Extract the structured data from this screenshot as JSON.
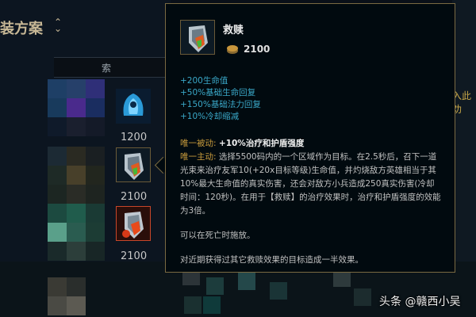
{
  "page": {
    "title": "装方案",
    "sort_icon": "up-down-chevron-icon"
  },
  "search": {
    "tab_text": "索"
  },
  "right_partial_text": "入此劝",
  "item_list": [
    {
      "icon": "blue-cloak-item-icon",
      "price": "1200"
    },
    {
      "icon": "redemption-item-icon",
      "price": "2100"
    },
    {
      "icon": "redemption-item-selected-icon",
      "price": "2100"
    }
  ],
  "tooltip": {
    "name": "救赎",
    "gold_icon": "gold-coin-icon",
    "price": "2100",
    "stats": [
      "+200生命值",
      "+50%基础生命回复",
      "+150%基础法力回复",
      "+10%冷却缩减"
    ],
    "passive_label": "唯一被动:",
    "passive_text": "+10%治疗和护盾强度",
    "active_label": "唯一主动:",
    "active_text": "选择5500码内的一个区域作为目标。在2.5秒后，召下一道光束来治疗友军10(+20x目标等级)生命值，并灼烧敌方英雄相当于其10%最大生命值的真实伤害，还会对敌方小兵造成250真实伤害(冷却时间：120秒)。在用于【救赎】的治疗效果时，治疗和护盾强度的效能为3倍。",
    "note1": "可以在死亡时施放。",
    "note2": "对近期获得过其它救赎效果的目标造成一半效果。"
  },
  "watermark": "头条 @赣西小吴",
  "colors": {
    "gold": "#c89b3c",
    "stat": "#3aa8c8",
    "border": "#7a6a42"
  }
}
